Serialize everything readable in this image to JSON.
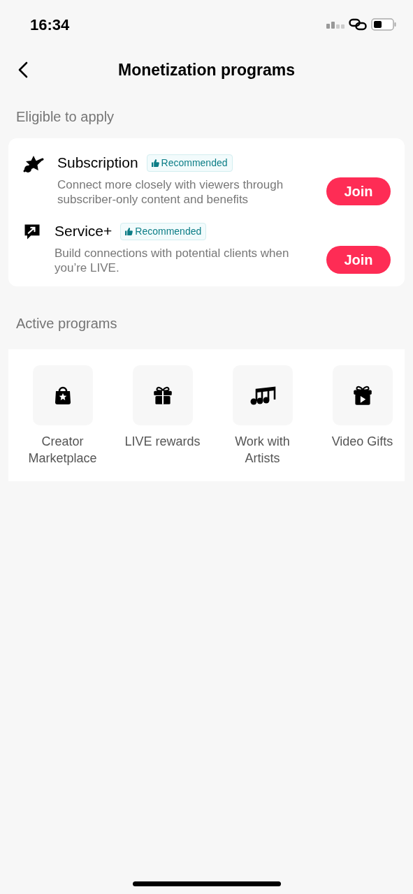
{
  "status_bar": {
    "time": "16:34"
  },
  "header": {
    "title": "Monetization programs"
  },
  "eligible": {
    "heading": "Eligible to apply",
    "programs": [
      {
        "name": "Subscription",
        "badge": "Recommended",
        "description": "Connect more closely with viewers through subscriber-only content and benefits",
        "button": "Join"
      },
      {
        "name": "Service+",
        "badge": "Recommended",
        "description": "Build connections with potential clients when you’re LIVE.",
        "button": "Join"
      }
    ]
  },
  "active": {
    "heading": "Active programs",
    "programs": [
      {
        "label": "Creator Marketplace"
      },
      {
        "label": "LIVE rewards"
      },
      {
        "label": "Work with Artists"
      },
      {
        "label": "Video Gifts"
      }
    ]
  }
}
